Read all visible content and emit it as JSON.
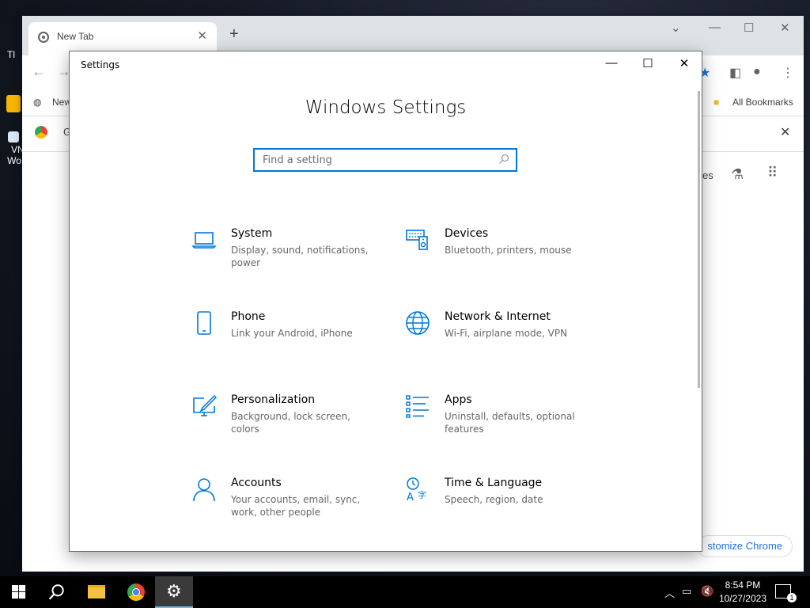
{
  "chrome": {
    "tab_title": "New Tab",
    "bookmark_partial": "New",
    "all_bookmarks": "All Bookmarks",
    "infobar_partial": "G",
    "right_partial": "es",
    "customize_label": "stomize Chrome"
  },
  "desktop": {
    "icon1_partial": "Tl",
    "icon2_partial_a": "VN",
    "icon2_partial_b": "Wo"
  },
  "settings": {
    "window_title": "Settings",
    "heading": "Windows Settings",
    "search_placeholder": "Find a setting",
    "tiles": [
      {
        "icon": "laptop-icon",
        "title": "System",
        "desc": "Display, sound, notifications, power"
      },
      {
        "icon": "keyboard-speaker-icon",
        "title": "Devices",
        "desc": "Bluetooth, printers, mouse"
      },
      {
        "icon": "phone-icon",
        "title": "Phone",
        "desc": "Link your Android, iPhone"
      },
      {
        "icon": "globe-icon",
        "title": "Network & Internet",
        "desc": "Wi-Fi, airplane mode, VPN"
      },
      {
        "icon": "paint-monitor-icon",
        "title": "Personalization",
        "desc": "Background, lock screen, colors"
      },
      {
        "icon": "apps-list-icon",
        "title": "Apps",
        "desc": "Uninstall, defaults, optional features"
      },
      {
        "icon": "person-icon",
        "title": "Accounts",
        "desc": "Your accounts, email, sync, work, other people"
      },
      {
        "icon": "time-language-icon",
        "title": "Time & Language",
        "desc": "Speech, region, date"
      }
    ],
    "accent": "#0078d7"
  },
  "taskbar": {
    "time": "8:54 PM",
    "date": "10/27/2023",
    "notification_count": "1"
  }
}
